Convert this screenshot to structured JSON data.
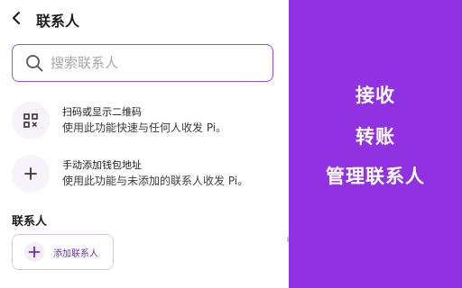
{
  "header": {
    "back_icon": "chevron-left-icon",
    "title": "联系人"
  },
  "search": {
    "icon": "search-icon",
    "placeholder": "搜索联系人",
    "value": ""
  },
  "options": [
    {
      "icon": "qr-code-icon",
      "title": "扫码或显示二维码",
      "description": "使用此功能快速与任何人收发 Pi。"
    },
    {
      "icon": "plus-icon",
      "title": "手动添加钱包地址",
      "description": "使用此功能与未添加的联系人收发 Pi。"
    }
  ],
  "contacts_section": {
    "title": "联系人",
    "add_button_label": "添加联系人",
    "add_button_icon": "plus-icon"
  },
  "right_panel": {
    "items": [
      "接收",
      "转账",
      "管理联系人"
    ]
  },
  "colors": {
    "accent": "#9132e2",
    "input_border": "#9c4fe6",
    "icon_bg": "#f6f3fa"
  }
}
